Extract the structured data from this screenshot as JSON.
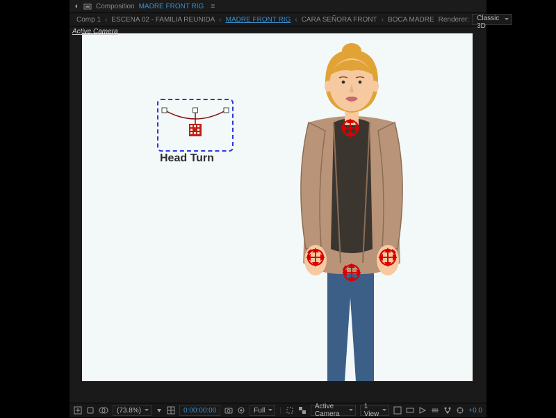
{
  "tab": {
    "icon": "composition-icon",
    "prefix": "Composition",
    "name": "MADRE FRONT RIG",
    "menu": "≡"
  },
  "breadcrumbs": {
    "items": [
      {
        "label": "Comp 1",
        "active": false
      },
      {
        "label": "ESCENA 02 - FAMILIA REUNIDA",
        "active": false
      },
      {
        "label": "MADRE FRONT RIG",
        "active": true
      },
      {
        "label": "CARA SEÑORA FRONT",
        "active": false
      },
      {
        "label": "BOCA MADRE",
        "active": false
      }
    ],
    "renderer_label": "Renderer:",
    "renderer_value": "Classic 3D"
  },
  "viewport": {
    "camera_label": "Active Camera",
    "control_label": "Head Turn"
  },
  "rig_colors": {
    "control": "#d90000",
    "curve": "#801010"
  },
  "footer": {
    "zoom": "(73.8%)",
    "timecode": "0:00:00:00",
    "resolution": "Full",
    "camera": "Active Camera",
    "views": "1 View",
    "exposure": "+0.0"
  }
}
